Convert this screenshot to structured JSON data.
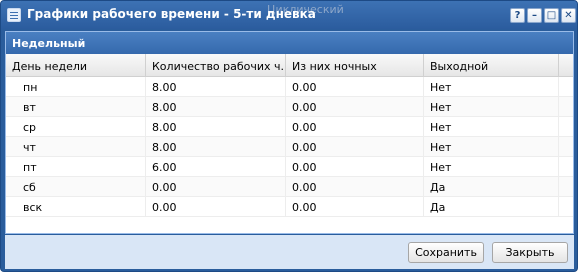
{
  "window": {
    "title": "Графики рабочего времени - 5-ти дневка",
    "ghost_text": "Циклический",
    "controls": {
      "help": "?",
      "minimize": "–",
      "maximize": "□",
      "close": "✕"
    }
  },
  "panel": {
    "title": "Недельный"
  },
  "grid": {
    "columns": [
      "День недели",
      "Количество рабочих ч...",
      "Из них ночных",
      "Выходной"
    ],
    "rows": [
      [
        "пн",
        "8.00",
        "0.00",
        "Нет"
      ],
      [
        "вт",
        "8.00",
        "0.00",
        "Нет"
      ],
      [
        "ср",
        "8.00",
        "0.00",
        "Нет"
      ],
      [
        "чт",
        "8.00",
        "0.00",
        "Нет"
      ],
      [
        "пт",
        "6.00",
        "0.00",
        "Нет"
      ],
      [
        "сб",
        "0.00",
        "0.00",
        "Да"
      ],
      [
        "вск",
        "0.00",
        "0.00",
        "Да"
      ]
    ]
  },
  "footer": {
    "save_label": "Сохранить",
    "close_label": "Закрыть"
  }
}
